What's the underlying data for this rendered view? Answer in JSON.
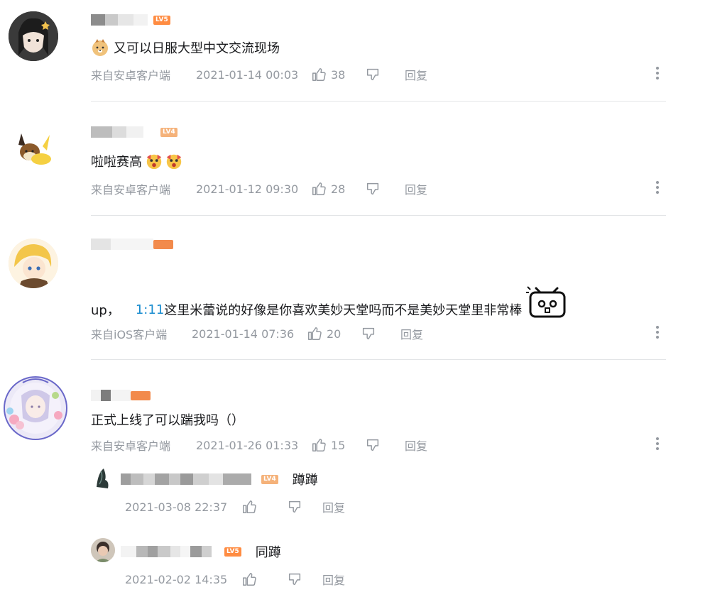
{
  "comments": [
    {
      "text": "又可以日服大型中文交流现场",
      "source": "来自安卓客户端",
      "time": "2021-01-14 00:03",
      "likes": "38",
      "reply_label": "回复",
      "level": "LV5"
    },
    {
      "text": "啦啦赛高",
      "source": "来自安卓客户端",
      "time": "2021-01-12 09:30",
      "likes": "28",
      "reply_label": "回复",
      "level": "LV4"
    },
    {
      "text_prefix": "up，",
      "text_link": "1:11",
      "text_suffix": "这里米蕾说的好像是你喜欢美妙天堂吗而不是美妙天堂里非常棒",
      "source": "来自iOS客户端",
      "time": "2021-01-14 07:36",
      "likes": "20",
      "reply_label": "回复"
    },
    {
      "text": "正式上线了可以踹我吗（）",
      "source": "来自安卓客户端",
      "time": "2021-01-26 01:33",
      "likes": "15",
      "reply_label": "回复",
      "replies": [
        {
          "text": "蹲蹲",
          "time": "2021-03-08 22:37",
          "reply_label": "回复",
          "level": "LV4"
        },
        {
          "text": "同蹲",
          "time": "2021-02-02 14:35",
          "reply_label": "回复",
          "level": "LV5"
        }
      ]
    }
  ]
}
